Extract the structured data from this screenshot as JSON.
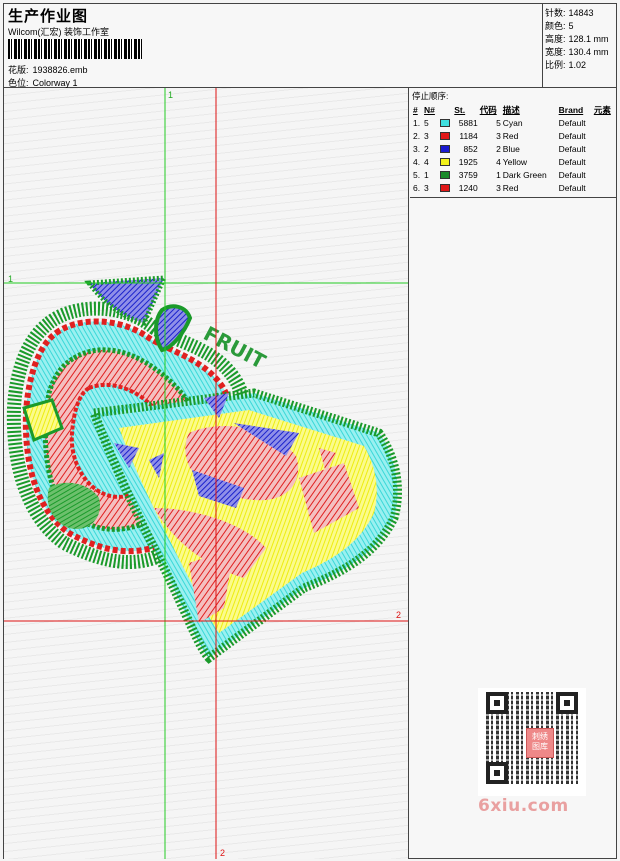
{
  "header": {
    "title": "生产作业图",
    "studio": "Wilcom(汇宏) 装饰工作室",
    "pattern_label": "花版:",
    "pattern_value": "1938826.emb",
    "colorway_label": "色位:",
    "colorway_value": "Colorway 1"
  },
  "stats": {
    "stitches_label": "针数:",
    "stitches_value": "14843",
    "colors_label": "颜色:",
    "colors_value": "5",
    "height_label": "高度:",
    "height_value": "128.1 mm",
    "width_label": "宽度:",
    "width_value": "130.4 mm",
    "ratio_label": "比例:",
    "ratio_value": "1.02"
  },
  "guides": {
    "top_label": "1",
    "left_label": "1",
    "right_label": "2",
    "bottom_label": "2"
  },
  "design_text": "FRUIT",
  "stop_sequence": {
    "title": "停止顺序:",
    "headers": [
      "#",
      "N#",
      "St.",
      "代码",
      "描述",
      "Brand",
      "元素"
    ],
    "rows": [
      {
        "idx": "1.",
        "n": "5",
        "color": "#3fe0e0",
        "st": "5881",
        "code": "5",
        "desc": "Cyan",
        "brand": "Default"
      },
      {
        "idx": "2.",
        "n": "3",
        "color": "#e01818",
        "st": "1184",
        "code": "3",
        "desc": "Red",
        "brand": "Default"
      },
      {
        "idx": "3.",
        "n": "2",
        "color": "#1a1ad0",
        "st": "852",
        "code": "2",
        "desc": "Blue",
        "brand": "Default"
      },
      {
        "idx": "4.",
        "n": "4",
        "color": "#f2f21a",
        "st": "1925",
        "code": "4",
        "desc": "Yellow",
        "brand": "Default"
      },
      {
        "idx": "5.",
        "n": "1",
        "color": "#1a8a2a",
        "st": "3759",
        "code": "1",
        "desc": "Dark Green",
        "brand": "Default"
      },
      {
        "idx": "6.",
        "n": "3",
        "color": "#e01818",
        "st": "1240",
        "code": "3",
        "desc": "Red",
        "brand": "Default"
      }
    ]
  },
  "qr_badge": "刺绣\n图库",
  "watermark": "6xiu.com",
  "colors": {
    "guide_green": "#22cc22",
    "guide_red": "#dd1111",
    "thread_green": "#1a9a2a",
    "thread_cyan": "#55e6e6",
    "thread_red": "#e02020",
    "thread_blue": "#1a22cc",
    "thread_yellow": "#f4f41c"
  }
}
